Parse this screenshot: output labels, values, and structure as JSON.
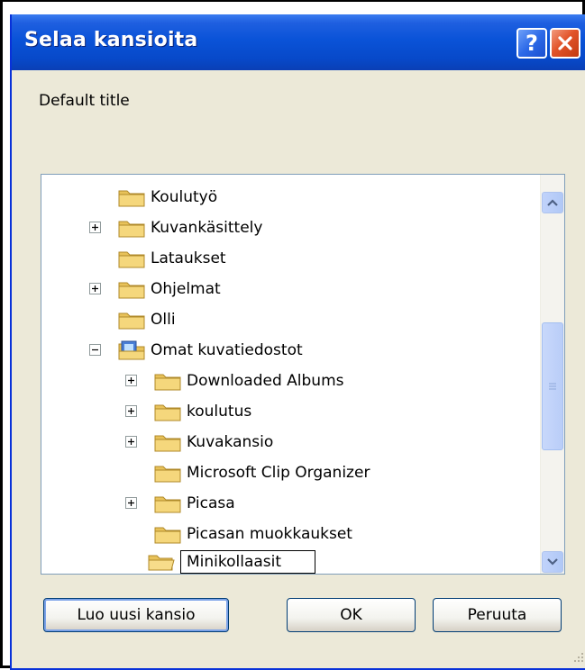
{
  "window": {
    "title": "Selaa kansioita",
    "help_label": "?"
  },
  "description": "Default title",
  "tree": {
    "items": [
      {
        "label": "Koulutyö",
        "expander": "none",
        "level": 1
      },
      {
        "label": "Kuvankäsittely",
        "expander": "plus",
        "level": 1
      },
      {
        "label": "Lataukset",
        "expander": "none",
        "level": 1
      },
      {
        "label": "Ohjelmat",
        "expander": "plus",
        "level": 1
      },
      {
        "label": "Olli",
        "expander": "none",
        "level": 1
      },
      {
        "label": "Omat kuvatiedostot",
        "expander": "minus",
        "level": 1
      },
      {
        "label": "Downloaded Albums",
        "expander": "plus",
        "level": 2
      },
      {
        "label": "koulutus",
        "expander": "plus",
        "level": 2
      },
      {
        "label": "Kuvakansio",
        "expander": "plus",
        "level": 2
      },
      {
        "label": "Microsoft Clip Organizer",
        "expander": "none",
        "level": 2
      },
      {
        "label": "Picasa",
        "expander": "plus",
        "level": 2
      },
      {
        "label": "Picasan muokkaukset",
        "expander": "none",
        "level": 2
      }
    ],
    "editing": {
      "value": "Minikollaasit"
    }
  },
  "buttons": {
    "new_folder": "Luo uusi kansio",
    "ok": "OK",
    "cancel": "Peruuta"
  },
  "colors": {
    "title_bar": "#0a53d8",
    "close_button": "#e2542a",
    "dialog_face": "#ece9d8"
  }
}
